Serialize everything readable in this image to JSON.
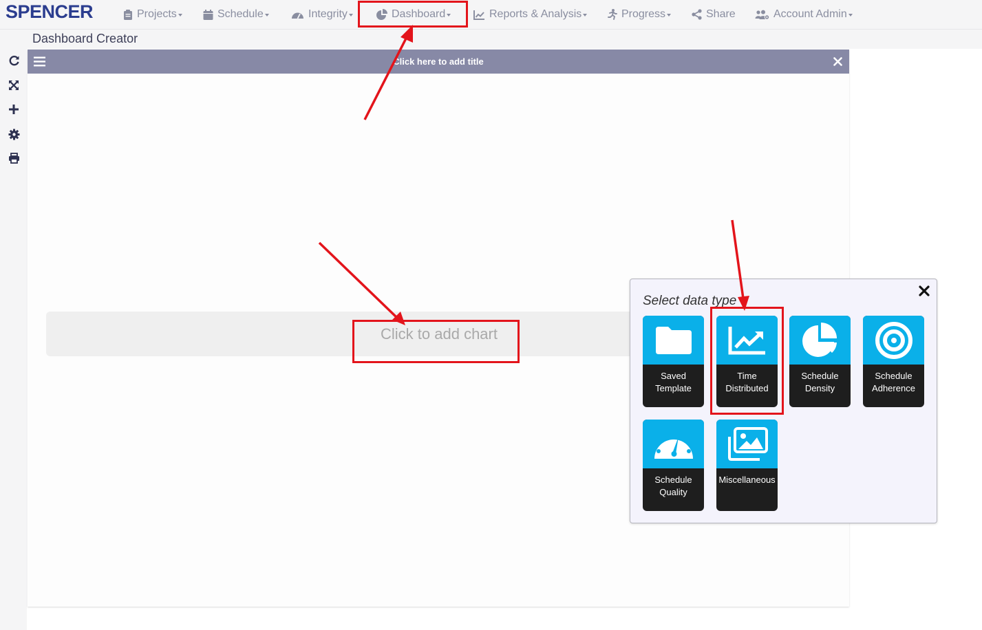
{
  "brand": "SPENCER",
  "nav": {
    "projects": "Projects",
    "schedule": "Schedule",
    "integrity": "Integrity",
    "dashboard": "Dashboard",
    "reports": "Reports & Analysis",
    "progress": "Progress",
    "share": "Share",
    "account_admin": "Account Admin"
  },
  "page_title": "Dashboard Creator",
  "panel": {
    "title_placeholder": "Click here to add title",
    "chart_placeholder": "Click to add chart"
  },
  "modal": {
    "title": "Select data type",
    "tiles": [
      {
        "line1": "Saved",
        "line2": "Template",
        "icon": "folder-icon"
      },
      {
        "line1": "Time",
        "line2": "Distributed",
        "icon": "line-chart-icon"
      },
      {
        "line1": "Schedule",
        "line2": "Density",
        "icon": "pie-chart-icon"
      },
      {
        "line1": "Schedule",
        "line2": "Adherence",
        "icon": "target-icon"
      },
      {
        "line1": "Schedule",
        "line2": "Quality",
        "icon": "gauge-icon"
      },
      {
        "line1": "Miscellaneous",
        "line2": "",
        "icon": "images-icon"
      }
    ]
  },
  "colors": {
    "brand": "#2b3d8f",
    "panel_header": "#8789a6",
    "tile_accent": "#0ab0e9",
    "tile_base": "#1e1e1e",
    "annotation_red": "#e3141b"
  }
}
